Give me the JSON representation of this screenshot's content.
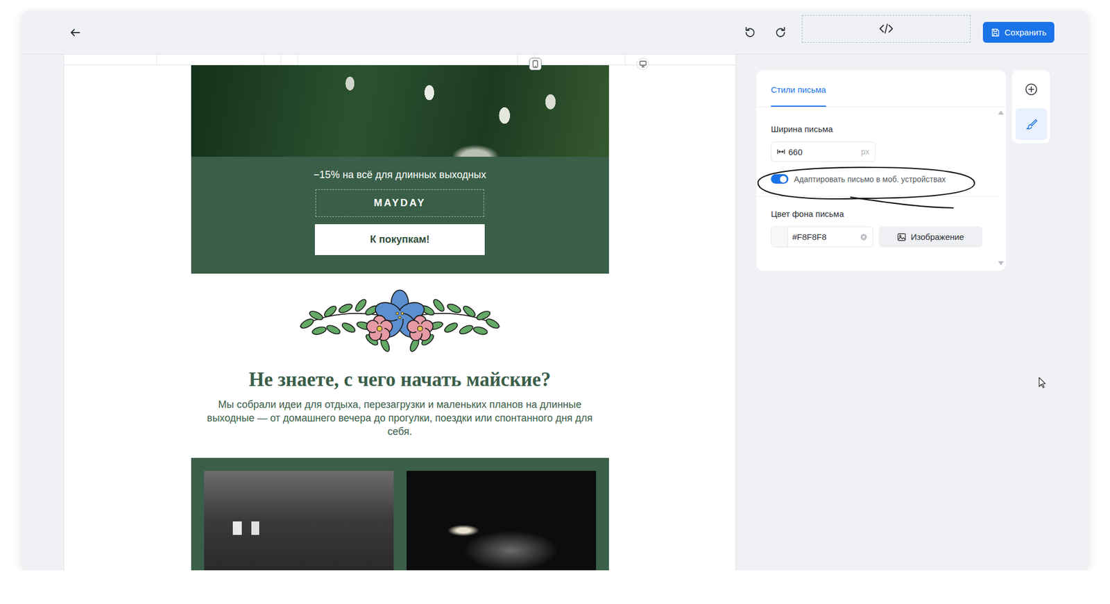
{
  "toolbar": {
    "save_label": "Сохранить"
  },
  "canvas": {
    "devices": [
      {
        "kind": "mobile",
        "selected": true
      },
      {
        "kind": "desktop",
        "selected": false
      }
    ]
  },
  "email": {
    "promo": {
      "text": "−15% на всё для длинных выходных",
      "code": "MAYDAY",
      "button": "К покупкам!"
    },
    "intro": {
      "heading": "Не знаете, с чего начать майские?",
      "text": "Мы собрали идеи для отдыха, перезагрузки и маленьких планов на длинные выходные — от домашнего вечера до прогулки, поездки или спонтанного дня для себя."
    }
  },
  "panel": {
    "tabs": [
      {
        "label": "Стили письма",
        "selected": true
      }
    ],
    "width": {
      "label": "Ширина письма",
      "value": "660",
      "unit": "px"
    },
    "adapt_toggle": {
      "label": "Адаптировать письмо в моб. устройствах",
      "on": true
    },
    "background": {
      "label": "Цвет фона письма",
      "value": "#F8F8F8",
      "image_button": "Изображение"
    }
  },
  "side_tools": [
    {
      "kind": "add",
      "selected": false
    },
    {
      "kind": "brush",
      "selected": true
    }
  ]
}
